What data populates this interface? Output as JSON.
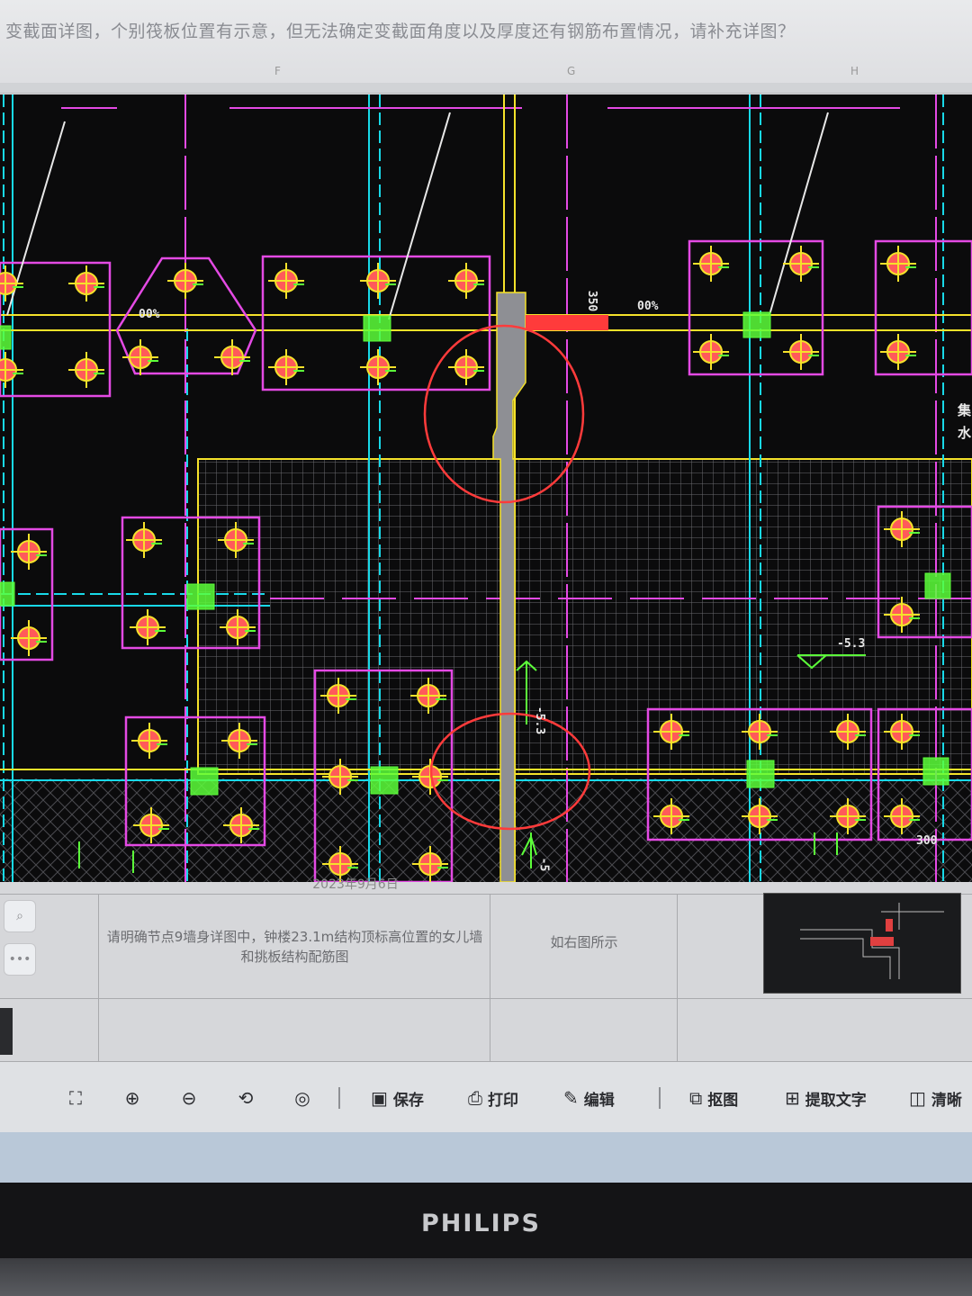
{
  "question": {
    "text": "变截面详图，个别筏板位置有示意，但无法确定变截面角度以及厚度还有钢筋布置情况，请补充详图？"
  },
  "column_headers": [
    "F",
    "G",
    "H"
  ],
  "cad": {
    "labels": {
      "slope_left": "00%",
      "slope_right": "00%",
      "dim_vertical": "350",
      "elev_right": "-5.3",
      "elev_mid": "-5.3",
      "elev_bottom": "-5",
      "dim_bottom": "300",
      "side_note_1": "集",
      "side_note_2": "水"
    },
    "colors": {
      "background": "#0b0b0c",
      "pile": "#ff5a5a",
      "cap": "#e44ae4",
      "beam": "#f5e22a",
      "axis": "#18d9e8",
      "marker": "#5cff3a",
      "highlight": "#ff3b3b"
    }
  },
  "table": {
    "date_fragment": "2023年9月6日",
    "row": {
      "question": "请明确节点9墙身详图中，钟楼23.1m结构顶标高位置的女儿墙和挑板结构配筋图",
      "answer": "如右图所示"
    }
  },
  "toolbar": {
    "icons": [
      "fit-screen",
      "zoom-in",
      "zoom-out",
      "rotate",
      "locate"
    ],
    "save": "保存",
    "print": "打印",
    "edit": "编辑",
    "crop": "抠图",
    "extract_text": "提取文字",
    "clear": "清晰"
  },
  "monitor": {
    "brand": "PHILIPS"
  }
}
